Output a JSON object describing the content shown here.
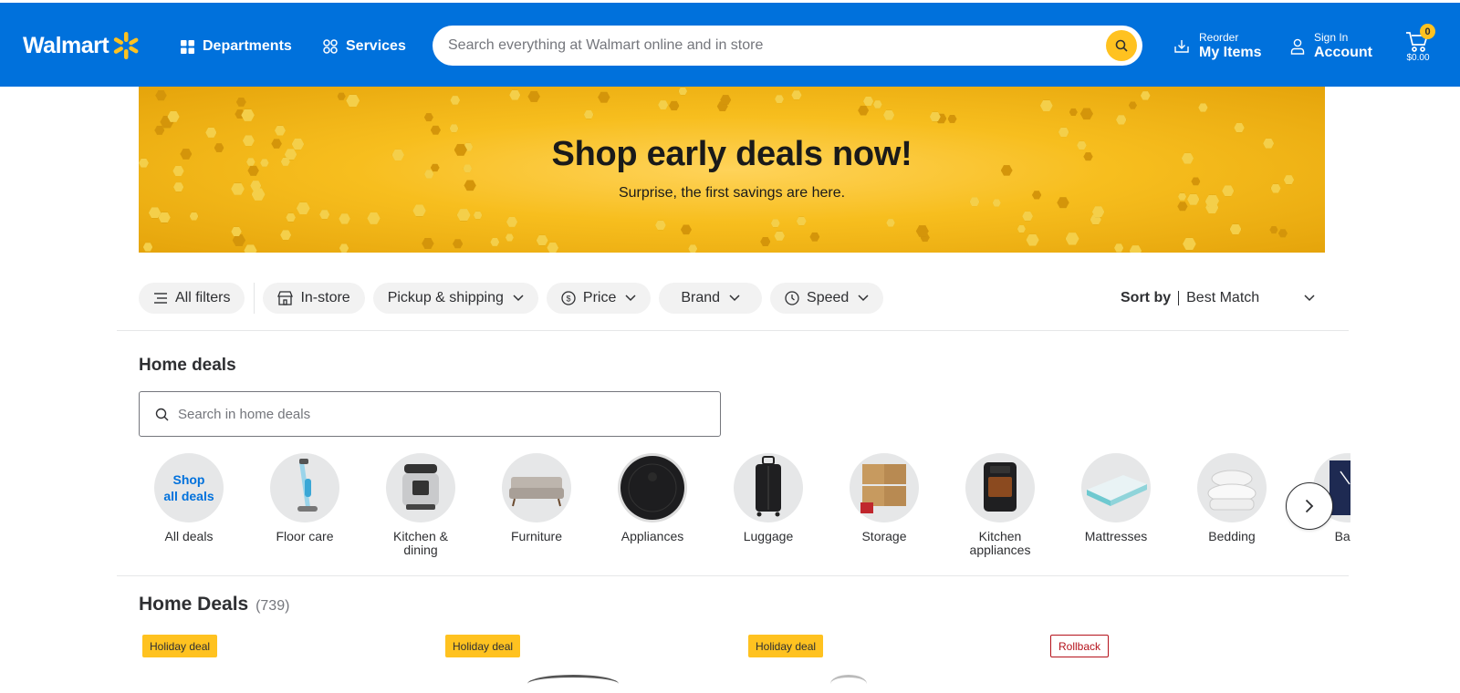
{
  "header": {
    "brand": "Walmart",
    "departments_label": "Departments",
    "services_label": "Services",
    "search_placeholder": "Search everything at Walmart online and in store",
    "reorder_small": "Reorder",
    "reorder_big": "My Items",
    "signin_small": "Sign In",
    "signin_big": "Account",
    "cart_count": "0",
    "cart_total": "$0.00",
    "colors": {
      "bar": "#0071dc",
      "spark": "#ffc220"
    }
  },
  "banner": {
    "title": "Shop early deals now!",
    "subtitle": "Surprise, the first savings are here."
  },
  "filters": {
    "all_filters": "All filters",
    "in_store": "In-store",
    "pickup": "Pickup & shipping",
    "price": "Price",
    "brand": "Brand",
    "speed": "Speed",
    "sort_label": "Sort by",
    "sort_value": "Best Match"
  },
  "home_deals": {
    "title": "Home deals",
    "search_placeholder": "Search in home deals",
    "categories": [
      {
        "label": "All deals",
        "circle_text_1": "Shop",
        "circle_text_2": "all deals"
      },
      {
        "label": "Floor care"
      },
      {
        "label": "Kitchen & dining"
      },
      {
        "label": "Furniture"
      },
      {
        "label": "Appliances"
      },
      {
        "label": "Luggage"
      },
      {
        "label": "Storage"
      },
      {
        "label": "Kitchen appliances"
      },
      {
        "label": "Mattresses"
      },
      {
        "label": "Bedding"
      },
      {
        "label": "Bath"
      }
    ]
  },
  "results": {
    "title": "Home Deals",
    "count": "(739)",
    "badges": [
      "Holiday deal",
      "Holiday deal",
      "Holiday deal",
      "Rollback"
    ]
  }
}
